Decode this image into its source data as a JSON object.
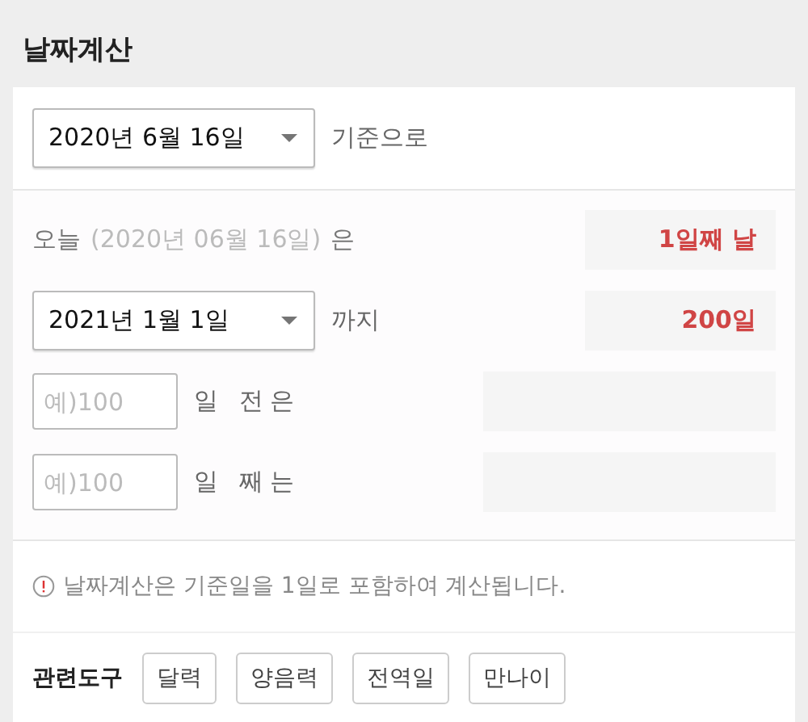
{
  "title": "날짜계산",
  "base": {
    "date": "2020년 6월 16일",
    "suffix": "기준으로"
  },
  "rows": [
    {
      "kind": "today",
      "label": "오늘",
      "date": "(2020년 06월 16일)",
      "suffix": "은",
      "result": "1일째 날"
    },
    {
      "kind": "select",
      "date": "2021년 1월 1일",
      "suffix": "까지",
      "result": "200일"
    },
    {
      "kind": "input",
      "placeholder": "예)100",
      "suffix": "일 전은"
    },
    {
      "kind": "input",
      "placeholder": "예)100",
      "suffix": "일 째는"
    }
  ],
  "notice": "날짜계산은 기준일을 1일로 포함하여 계산됩니다.",
  "tools": {
    "label": "관련도구",
    "buttons": [
      "달력",
      "양음력",
      "전역일",
      "만나이"
    ]
  }
}
